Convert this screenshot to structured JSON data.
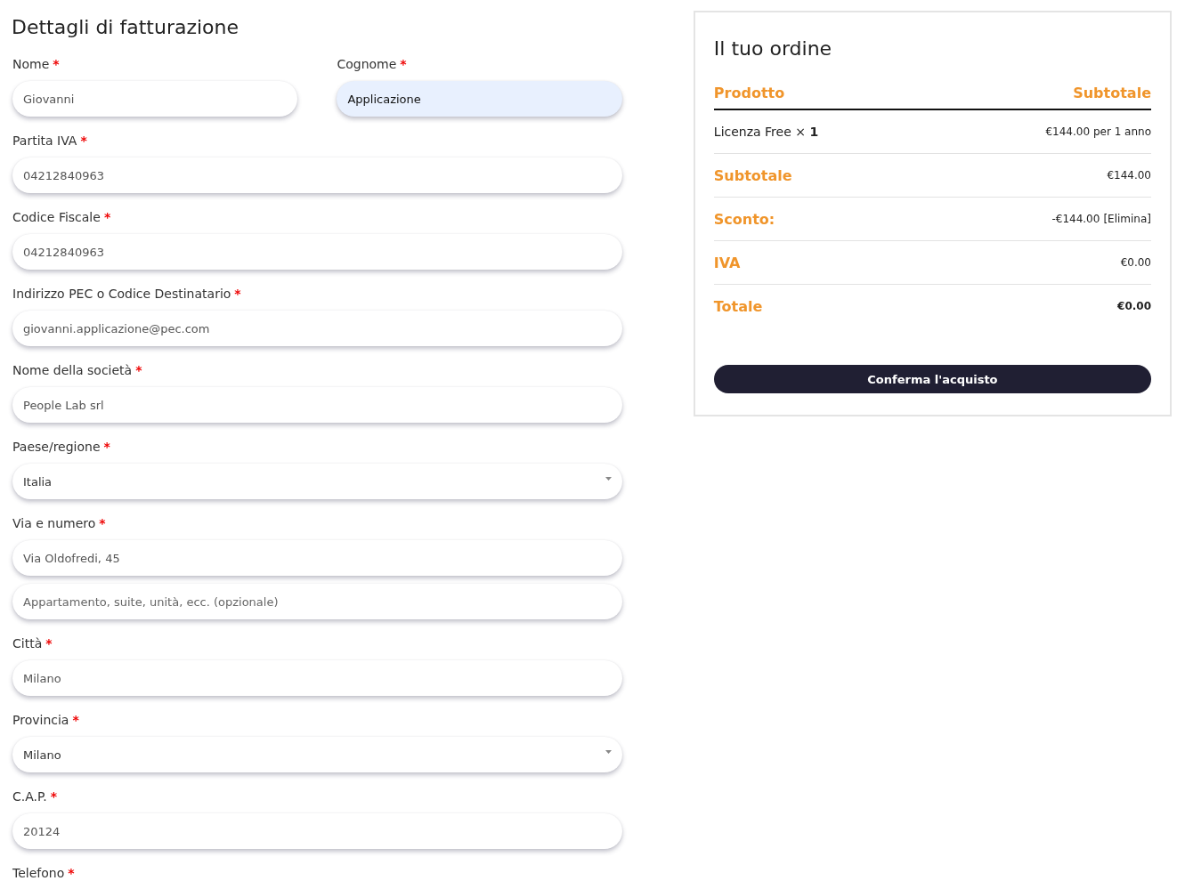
{
  "billing": {
    "title": "Dettagli di fatturazione",
    "name_row": [
      {
        "label": "Nome",
        "asterisk": "*",
        "kind": "text",
        "value": "Giovanni",
        "autofilled": false
      },
      {
        "label": "Cognome",
        "asterisk": "*",
        "kind": "text",
        "value": "Applicazione",
        "autofilled": true
      }
    ],
    "fields": [
      {
        "label": "Partita IVA",
        "asterisk": "*",
        "kind": "text",
        "value": "04212840963"
      },
      {
        "label": "Codice Fiscale",
        "asterisk": "*",
        "kind": "text",
        "value": "04212840963"
      },
      {
        "label": "Indirizzo PEC o Codice Destinatario",
        "asterisk": "*",
        "kind": "text",
        "value": "giovanni.applicazione@pec.com"
      },
      {
        "label": "Nome della società",
        "asterisk": "*",
        "kind": "text",
        "value": "People Lab srl"
      },
      {
        "label": "Paese/regione",
        "asterisk": "*",
        "kind": "select",
        "value": "Italia"
      },
      {
        "label": "Via e numero",
        "asterisk": "*",
        "kind": "text",
        "value": "Via Oldofredi, 45",
        "extra_placeholder": "Appartamento, suite, unità, ecc. (opzionale)"
      },
      {
        "label": "Città",
        "asterisk": "*",
        "kind": "text",
        "value": "Milano"
      },
      {
        "label": "Provincia",
        "asterisk": "*",
        "kind": "select",
        "value": "Milano"
      },
      {
        "label": "C.A.P.",
        "asterisk": "*",
        "kind": "text",
        "value": "20124"
      },
      {
        "label": "Telefono",
        "asterisk": "*",
        "kind": "label_only"
      }
    ]
  },
  "order": {
    "title": "Il tuo ordine",
    "columns": [
      "Prodotto",
      "Subtotale"
    ],
    "item": {
      "name": "Licenza Free",
      "quantity": "× **1**",
      "price": "€144.00 per 1 anno"
    },
    "totals": [
      {
        "label": "Subtotale",
        "value": "€144.00",
        "emphasis": false
      },
      {
        "label": "Sconto:",
        "value": "-€144.00",
        "link": "[Elimina]",
        "emphasis": false
      },
      {
        "label": "IVA",
        "value": "€0.00",
        "emphasis": false
      },
      {
        "label": "Totale",
        "value": "€0.00",
        "emphasis": true
      }
    ],
    "button": "Conferma l'acquisto"
  }
}
